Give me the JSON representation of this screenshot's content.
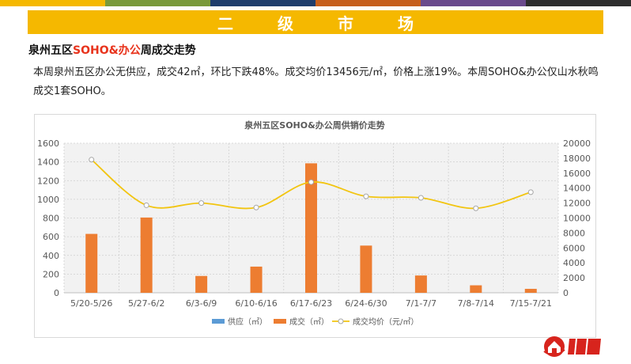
{
  "banner": {
    "title": "二级市场"
  },
  "colors": {
    "strip": [
      "#f5b800",
      "#7a9a3a",
      "#1f3d6b",
      "#c65f1c",
      "#6a4a8c",
      "#2e2e2e"
    ],
    "supply": "#5b9bd5",
    "deal": "#ed7d31",
    "price": "#f2c511"
  },
  "section": {
    "title_pre": "泉州五区",
    "title_hl": "SOHO&办公",
    "title_post": "周成交走势"
  },
  "description": "本周泉州五区办公无供应，成交42㎡，环比下跌48%。成交均价13456元/㎡，价格上涨19%。本周SOHO&办公仅山水秋鸣成交1套SOHO。",
  "chart_data": {
    "type": "bar",
    "title": "泉州五区SOHO&办公周供销价走势",
    "categories": [
      "5/20-5/26",
      "5/27-6/2",
      "6/3-6/9",
      "6/10-6/16",
      "6/17-6/23",
      "6/24-6/30",
      "7/1-7/7",
      "7/8-7/14",
      "7/15-7/21"
    ],
    "series": [
      {
        "name": "供应（㎡）",
        "type": "bar",
        "axis": "left",
        "values": [
          0,
          0,
          0,
          0,
          0,
          0,
          0,
          0,
          0
        ]
      },
      {
        "name": "成交（㎡）",
        "type": "bar",
        "axis": "left",
        "values": [
          630,
          805,
          180,
          280,
          1385,
          505,
          185,
          80,
          42
        ]
      },
      {
        "name": "成交均价（元/㎡）",
        "type": "line",
        "axis": "right",
        "values": [
          17800,
          11700,
          12000,
          11400,
          14800,
          12900,
          12700,
          11300,
          13456
        ]
      }
    ],
    "ylim_left": [
      0,
      1600
    ],
    "yticks_left": [
      0,
      200,
      400,
      600,
      800,
      1000,
      1200,
      1400,
      1600
    ],
    "ylim_right": [
      0,
      20000
    ],
    "yticks_right": [
      0,
      2000,
      4000,
      6000,
      8000,
      10000,
      12000,
      14000,
      16000,
      18000,
      20000
    ],
    "grid": true,
    "legend_position": "bottom"
  }
}
